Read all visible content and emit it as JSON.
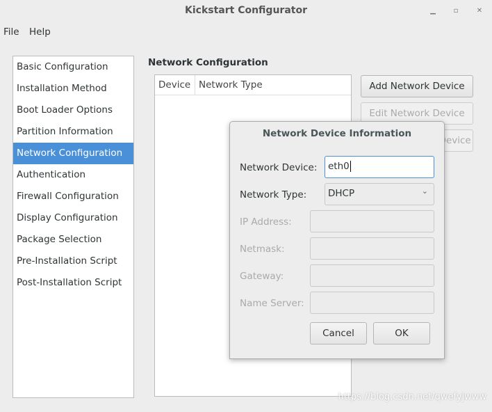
{
  "window": {
    "title": "Kickstart Configurator",
    "minimize": "▁",
    "maximize": "▫",
    "close": "✕"
  },
  "menu": [
    "File",
    "Help"
  ],
  "sidebar": {
    "items": [
      "Basic Configuration",
      "Installation Method",
      "Boot Loader Options",
      "Partition Information",
      "Network Configuration",
      "Authentication",
      "Firewall Configuration",
      "Display Configuration",
      "Package Selection",
      "Pre-Installation Script",
      "Post-Installation Script"
    ],
    "selected": "Network Configuration"
  },
  "main": {
    "section_title": "Network Configuration",
    "columns": [
      "Device",
      "Network Type"
    ],
    "buttons": {
      "add": "Add Network Device",
      "edit": "Edit Network Device",
      "delete": "Delete Network Device"
    }
  },
  "dialog": {
    "title": "Network Device Information",
    "device_label": "Network Device:",
    "device_value": "eth0",
    "type_label": "Network Type:",
    "type_value": "DHCP",
    "ip_label": "IP Address:",
    "netmask_label": "Netmask:",
    "gateway_label": "Gateway:",
    "nameserver_label": "Name Server:",
    "cancel": "Cancel",
    "ok": "OK"
  },
  "watermark": "https://blog.csdn.net/qwefyjwww",
  "colors": {
    "accent": "#4a90d9",
    "focus": "#4a90d9"
  }
}
